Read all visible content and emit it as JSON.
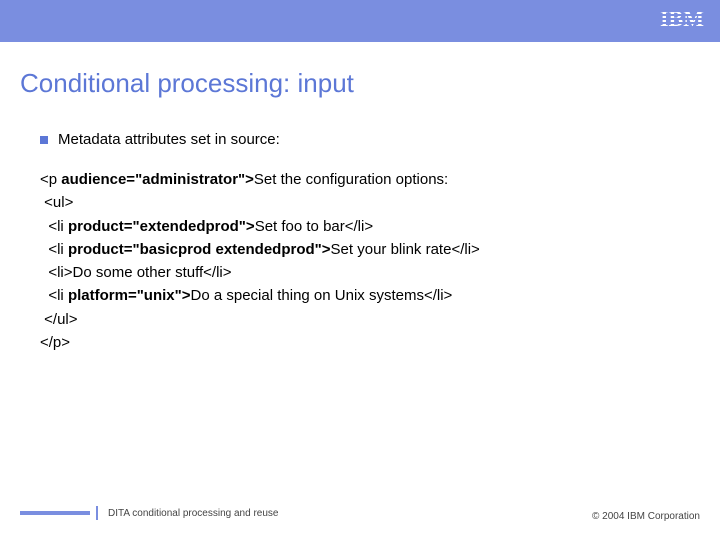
{
  "header": {
    "logo_text": "IBM"
  },
  "title": "Conditional processing: input",
  "bullet": {
    "text": "Metadata attributes set in source:"
  },
  "code": {
    "line1_a": "<p ",
    "line1_b": "audience=\"administrator\">",
    "line1_c": "Set the configuration options:",
    "line2": " <ul>",
    "line3_a": "  <li ",
    "line3_b": "product=\"extendedprod\">",
    "line3_c": "Set foo to bar</li>",
    "line4_a": "  <li ",
    "line4_b": "product=\"basicprod extendedprod\">",
    "line4_c": "Set your blink rate</li>",
    "line5": "  <li>Do some other stuff</li>",
    "line6_a": "  <li ",
    "line6_b": "platform=\"unix\">",
    "line6_c": "Do a special thing on Unix systems</li>",
    "line7": " </ul>",
    "line8": "</p>"
  },
  "footer": {
    "left": "DITA  conditional processing and reuse",
    "right": "© 2004 IBM Corporation"
  }
}
